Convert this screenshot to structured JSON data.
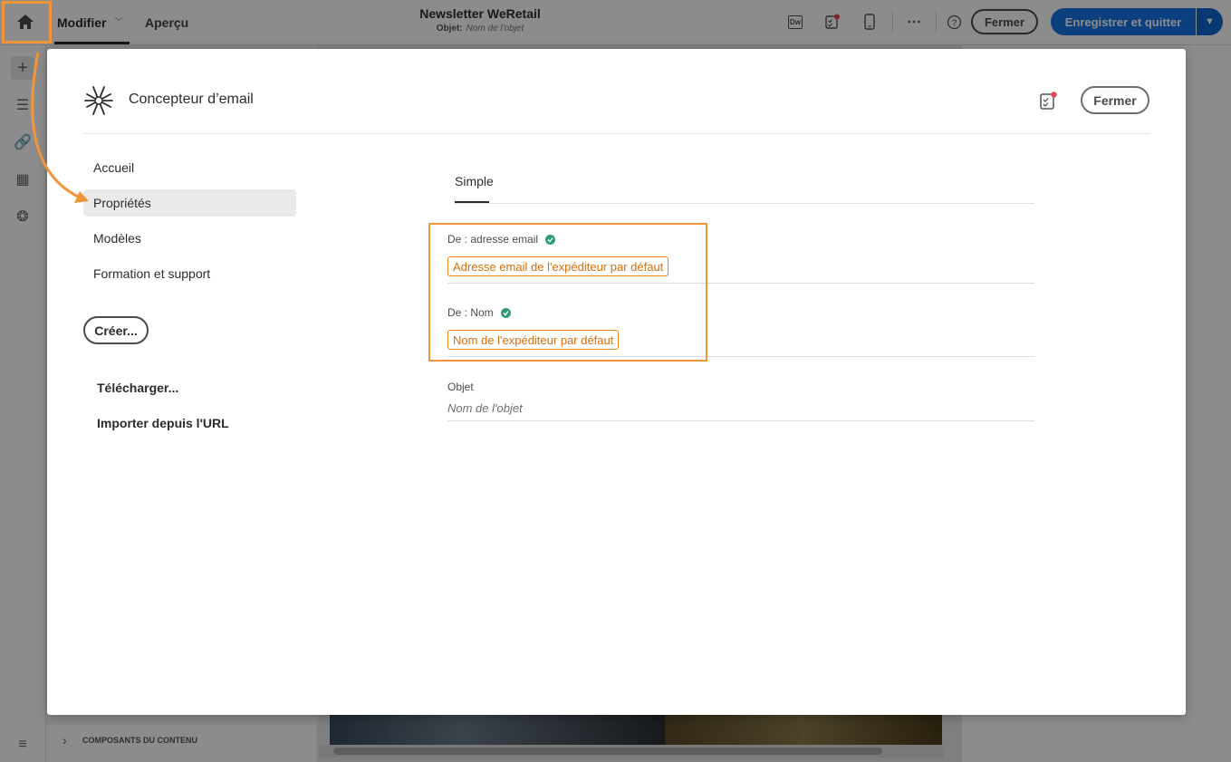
{
  "topbar": {
    "tab_modifier": "Modifier",
    "tab_apercu": "Aperçu",
    "doc_title": "Newsletter WeRetail",
    "subject_label": "Objet:",
    "subject_placeholder": "Nom de l'objet",
    "dw_icon_text": "Dw",
    "fermer": "Fermer",
    "save": "Enregistrer et quitter"
  },
  "background": {
    "composants": "COMPOSANTS DU CONTENU"
  },
  "modal": {
    "title": "Concepteur d’email",
    "fermer": "Fermer",
    "nav": [
      {
        "label": "Accueil"
      },
      {
        "label": "Propriétés"
      },
      {
        "label": "Modèles"
      },
      {
        "label": "Formation et support"
      }
    ],
    "creer": "Créer...",
    "telecharger": "Télécharger...",
    "importer": "Importer depuis l'URL",
    "tab": "Simple",
    "fields": {
      "from_email_label": "De : adresse email",
      "from_email_value": "Adresse email de l'expéditeur par défaut",
      "from_name_label": "De : Nom",
      "from_name_value": "Nom de l'expéditeur par défaut",
      "subject_label": "Objet",
      "subject_value": "Nom de l'objet"
    }
  },
  "colors": {
    "accent_orange": "#f0953a",
    "primary_blue": "#1473e6",
    "success_green": "#2d9d78"
  }
}
